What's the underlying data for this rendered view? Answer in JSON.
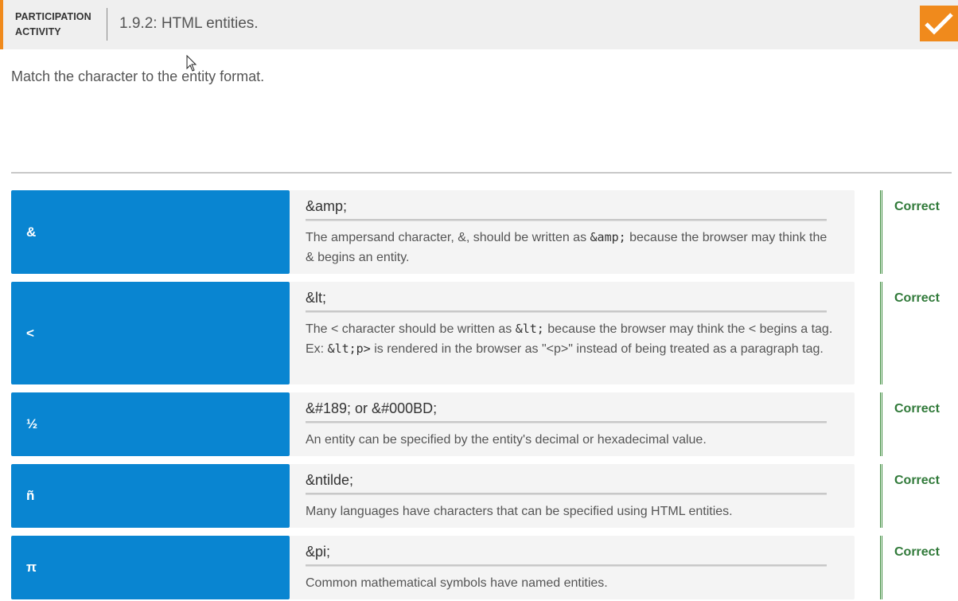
{
  "header": {
    "activity_type_line1": "PARTICIPATION",
    "activity_type_line2": "ACTIVITY",
    "title": "1.9.2: HTML entities."
  },
  "instructions": "Match the character to the entity format.",
  "colors": {
    "accent": "#f08a1c",
    "term_bg": "#0985d1",
    "bucket_bg": "#f4f4f4",
    "correct": "#317a3a"
  },
  "rows": [
    {
      "character": "&",
      "entity": "&amp;",
      "explanation": [
        {
          "t": "The ampersand character, &, should be written as "
        },
        {
          "t": "&amp;",
          "code": true
        },
        {
          "t": " because the browser may think the & begins an entity."
        }
      ],
      "status": "Correct"
    },
    {
      "character": "<",
      "entity": "&lt;",
      "explanation": [
        {
          "t": "The < character should be written as "
        },
        {
          "t": "&lt;",
          "code": true
        },
        {
          "t": " because the browser may think the < begins a tag. Ex: "
        },
        {
          "t": "&lt;p>",
          "code": true
        },
        {
          "t": " is rendered in the browser as \"<p>\" instead of being treated as a paragraph tag."
        }
      ],
      "status": "Correct"
    },
    {
      "character": "½",
      "entity": "&#189; or &#000BD;",
      "explanation": [
        {
          "t": "An entity can be specified by the entity's decimal or hexadecimal value."
        }
      ],
      "status": "Correct"
    },
    {
      "character": "ñ",
      "entity": "&ntilde;",
      "explanation": [
        {
          "t": "Many languages have characters that can be specified using HTML entities."
        }
      ],
      "status": "Correct"
    },
    {
      "character": "π",
      "entity": "&pi;",
      "explanation": [
        {
          "t": "Common mathematical symbols have named entities."
        }
      ],
      "status": "Correct"
    }
  ]
}
